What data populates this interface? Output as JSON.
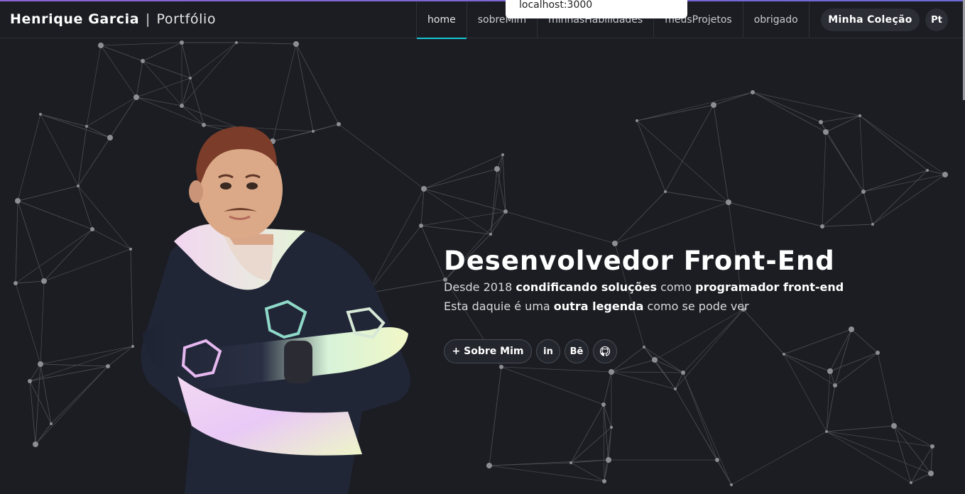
{
  "browser": {
    "status_url": "localhost:3000"
  },
  "navbar": {
    "brand_name": "Henrique Garcia",
    "brand_separator": "|",
    "brand_sub": "Portfólio",
    "links": [
      {
        "label": "home",
        "active": true
      },
      {
        "label": "sobreMim",
        "active": false
      },
      {
        "label": "minhasHabilidades",
        "active": false
      },
      {
        "label": "meusProjetos",
        "active": false
      },
      {
        "label": "obrigado",
        "active": false
      }
    ],
    "collection_button": "Minha Coleção",
    "language_button": "Pt"
  },
  "hero": {
    "title": "Desenvolvedor Front-End",
    "line1_prefix": "Desde 2018",
    "line1_bold1": "condificando soluções",
    "line1_mid": "como",
    "line1_bold2": "programador front-end",
    "line2_prefix": "Esta daquie é uma",
    "line2_bold": "outra legenda",
    "line2_suffix": "como se pode ver",
    "about_button": "+ Sobre Mim",
    "social": [
      {
        "icon": "linkedin-icon",
        "glyph": "in"
      },
      {
        "icon": "behance-icon",
        "glyph": "Bē"
      },
      {
        "icon": "github-icon",
        "glyph": ""
      }
    ]
  },
  "colors": {
    "background": "#1b1d22",
    "active_underline": "#19c6d8",
    "accent_bar": "#8a63d2",
    "button_bg": "#2b2e35"
  }
}
